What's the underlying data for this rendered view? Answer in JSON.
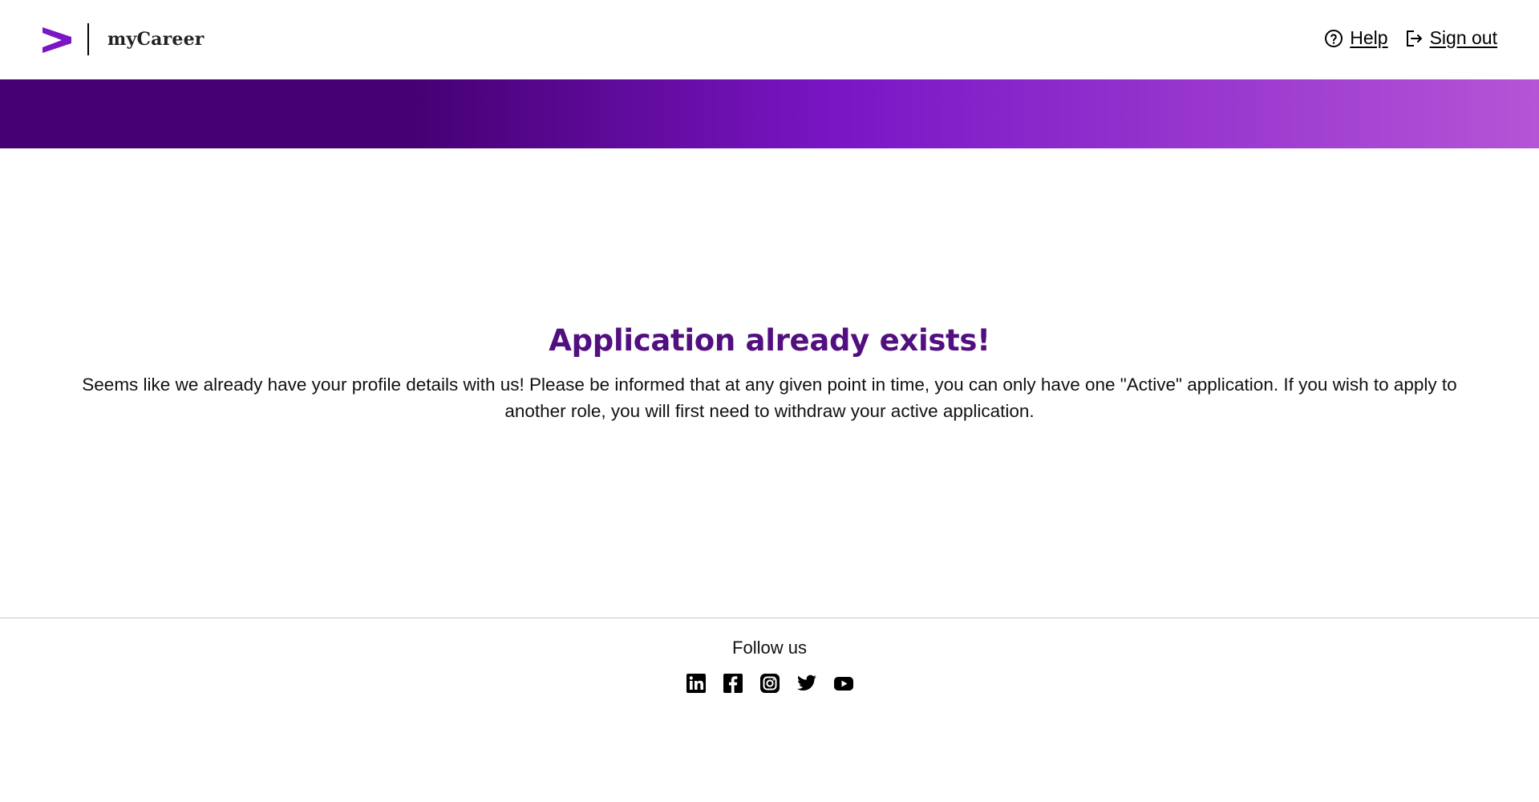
{
  "header": {
    "app_name": "myCareer",
    "help_label": "Help",
    "signout_label": "Sign out",
    "icons": {
      "logo": "accenture-greater-than-logo",
      "help": "question-circle-icon",
      "signout": "sign-out-icon"
    }
  },
  "colors": {
    "brand_purple": "#7a16c4",
    "title_purple": "#520f7f",
    "banner_dark": "#460073",
    "banner_mid": "#7b16c6",
    "banner_light": "#b455d6"
  },
  "main": {
    "title": "Application already exists!",
    "message": "Seems like we already have your profile details with us! Please be informed that at any given point in time, you can only have one \"Active\" application. If you wish to apply to another role, you will first need to withdraw your active application."
  },
  "footer": {
    "follow_label": "Follow us",
    "socials": [
      {
        "icon": "linkedin-icon"
      },
      {
        "icon": "facebook-icon"
      },
      {
        "icon": "instagram-icon"
      },
      {
        "icon": "twitter-icon"
      },
      {
        "icon": "youtube-icon"
      }
    ]
  }
}
